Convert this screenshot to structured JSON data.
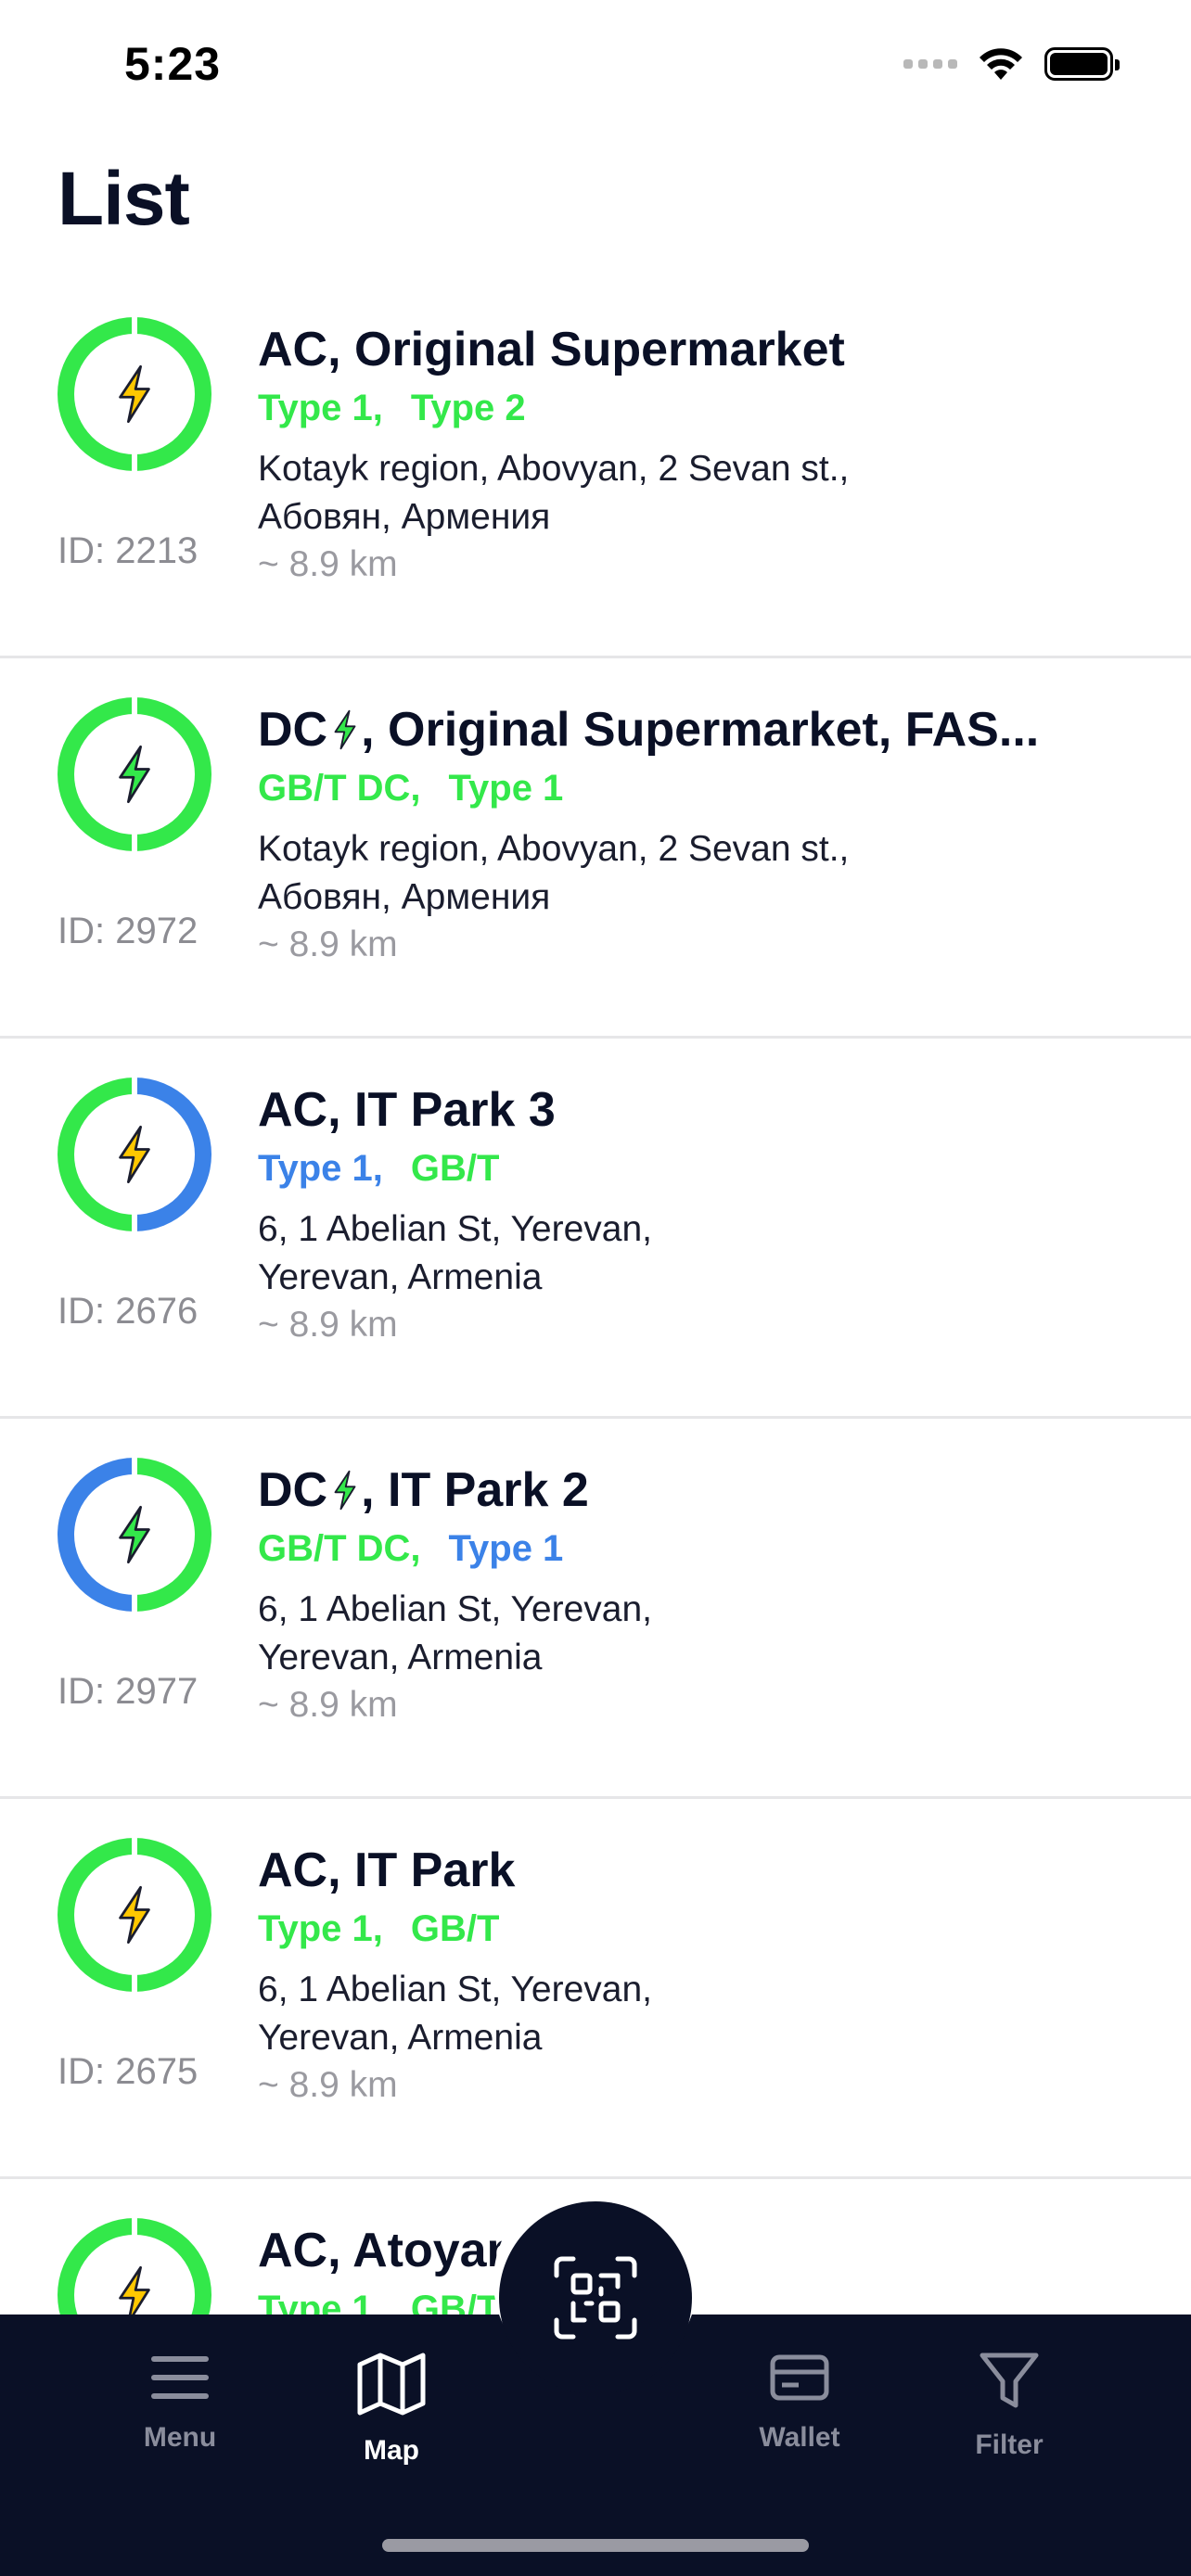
{
  "status_bar": {
    "time": "5:23"
  },
  "page": {
    "title": "List"
  },
  "stations": [
    {
      "name": "AC, Original Supermarket",
      "name_prefix": "",
      "name_suffix": "",
      "type": "AC",
      "connectors": [
        {
          "label": "Type 1,",
          "color": "green"
        },
        {
          "label": "Type 2",
          "color": "green"
        }
      ],
      "address_line1": "Kotayk region, Abovyan, 2 Sevan st.,",
      "address_line2": "Абовян, Армения",
      "distance": "~ 8.9 km",
      "id_text": "ID: 2213",
      "ring_colors": [
        "#33e84a",
        "#33e84a"
      ]
    },
    {
      "name": "",
      "name_prefix": "DC",
      "name_suffix": ", Original Supermarket, FAS...",
      "type": "DC",
      "connectors": [
        {
          "label": "GB/T DC,",
          "color": "green"
        },
        {
          "label": "Type 1",
          "color": "green"
        }
      ],
      "address_line1": "Kotayk region, Abovyan, 2 Sevan st.,",
      "address_line2": "Абовян, Армения",
      "distance": "~ 8.9 km",
      "id_text": "ID: 2972",
      "ring_colors": [
        "#33e84a",
        "#33e84a"
      ]
    },
    {
      "name": "AC, IT Park 3",
      "name_prefix": "",
      "name_suffix": "",
      "type": "AC",
      "connectors": [
        {
          "label": "Type 1,",
          "color": "blue"
        },
        {
          "label": "GB/T",
          "color": "green"
        }
      ],
      "address_line1": "6, 1 Abelian St, Yerevan,",
      "address_line2": "Yerevan, Armenia",
      "distance": "~ 8.9 km",
      "id_text": "ID: 2676",
      "ring_colors": [
        "#33e84a",
        "#3b82e8"
      ]
    },
    {
      "name": "",
      "name_prefix": "DC",
      "name_suffix": ", IT Park 2",
      "type": "DC",
      "connectors": [
        {
          "label": "GB/T DC,",
          "color": "green"
        },
        {
          "label": "Type 1",
          "color": "blue"
        }
      ],
      "address_line1": "6, 1 Abelian St, Yerevan,",
      "address_line2": "Yerevan, Armenia",
      "distance": "~ 8.9 km",
      "id_text": "ID: 2977",
      "ring_colors": [
        "#3b82e8",
        "#33e84a"
      ]
    },
    {
      "name": "AC, IT Park",
      "name_prefix": "",
      "name_suffix": "",
      "type": "AC",
      "connectors": [
        {
          "label": "Type 1,",
          "color": "green"
        },
        {
          "label": "GB/T",
          "color": "green"
        }
      ],
      "address_line1": "6, 1 Abelian St, Yerevan,",
      "address_line2": "Yerevan, Armenia",
      "distance": "~ 8.9 km",
      "id_text": "ID: 2675",
      "ring_colors": [
        "#33e84a",
        "#33e84a"
      ]
    },
    {
      "name": "AC, Atoyan",
      "name_prefix": "",
      "name_suffix": "",
      "type": "AC",
      "connectors": [
        {
          "label": "Type 1,",
          "color": "green"
        },
        {
          "label": "GB/T",
          "color": "green"
        }
      ],
      "address_line1": "",
      "address_line2": "",
      "distance": "",
      "id_text": "",
      "ring_colors": [
        "#33e84a",
        "#33e84a"
      ]
    }
  ],
  "tabs": [
    {
      "label": "Menu",
      "icon": "menu-icon",
      "active": false
    },
    {
      "label": "Map",
      "icon": "map-icon",
      "active": true
    },
    {
      "label": "Wallet",
      "icon": "wallet-icon",
      "active": false
    },
    {
      "label": "Filter",
      "icon": "filter-icon",
      "active": false
    }
  ],
  "scan_button": {
    "icon": "qr-scan-icon"
  },
  "colors": {
    "accent_green": "#33e84a",
    "accent_blue": "#3b82e8",
    "navy": "#0a1026",
    "ac_bolt": "#ffc800",
    "dc_bolt": "#33e84a"
  }
}
